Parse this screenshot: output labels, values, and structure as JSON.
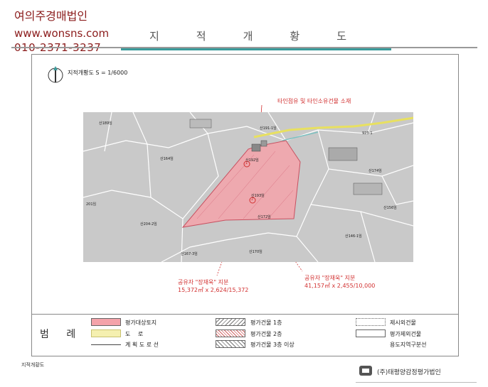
{
  "brand": {
    "name": "여의주경매법인",
    "url": "www.wonsns.com",
    "phone": "010-2371-3237"
  },
  "page_title": "지적개황도",
  "scale_label": "지적개황도 S = 1/6000",
  "notes": {
    "top": "타인점유 및 타인소유건물 소재",
    "left_line1": "공유자 \"장재욱\" 지분",
    "left_line2": "15,372㎡ x 2,624/15,372",
    "right_line1": "공유자 \"장재욱\" 지분",
    "right_line2": "41,157㎡ x 2,455/10,000"
  },
  "map": {
    "parcel_labels": [
      {
        "id": "a",
        "text": "산189임"
      },
      {
        "id": "b",
        "text": "산191-1임"
      },
      {
        "id": "c",
        "text": "923-1"
      },
      {
        "id": "d",
        "text": "산164임"
      },
      {
        "id": "e",
        "text": "산192임"
      },
      {
        "id": "f",
        "text": "산174임"
      },
      {
        "id": "g",
        "text": "산193임"
      },
      {
        "id": "h",
        "text": "산156임"
      },
      {
        "id": "i",
        "text": "산204-2임"
      },
      {
        "id": "j",
        "text": "산172임"
      },
      {
        "id": "k",
        "text": "산146-1임"
      },
      {
        "id": "l",
        "text": "산167-3임"
      },
      {
        "id": "m",
        "text": "산170임"
      },
      {
        "id": "n",
        "text": "201임"
      }
    ],
    "markers": [
      "1",
      "2"
    ]
  },
  "legend": {
    "title": "범 례",
    "items": [
      {
        "label": "평가대상토지",
        "swatch": "subject"
      },
      {
        "label": "도 로",
        "swatch": "road"
      },
      {
        "label": "계 획 도 로 선",
        "swatch": "planline"
      },
      {
        "label": "평가건물 1층",
        "swatch": "hatch1"
      },
      {
        "label": "평가건물 2층",
        "swatch": "hatch2"
      },
      {
        "label": "평가건물 3층 이상",
        "swatch": "hatch3"
      },
      {
        "label": "제시외건물",
        "swatch": "dotted"
      },
      {
        "label": "평가제외건물",
        "swatch": "blank"
      },
      {
        "label": "용도지역구분선",
        "swatch": "none"
      }
    ]
  },
  "footer": {
    "left": "지적개황도",
    "company": "(주)태평양감정평가법인"
  },
  "colors": {
    "brand": "#8b1c1c",
    "accent_rule": "#3a9a9a",
    "subject_fill": "#f4a3aa",
    "annotation": "#d23030",
    "road": "#e8e060"
  }
}
